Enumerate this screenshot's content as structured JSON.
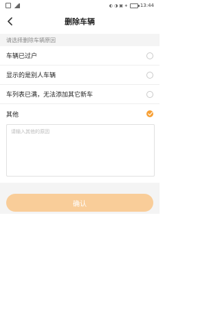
{
  "status_bar": {
    "left_indicators": "[Sm] .ull",
    "right_indicators": "☾ ◔ 🔔 ✱",
    "time": "13:44"
  },
  "header": {
    "title": "删除车辆",
    "back_icon": "chevron-left-icon"
  },
  "section_label": "请选择删除车辆原因",
  "options": [
    {
      "label": "车辆已过户",
      "checked": false
    },
    {
      "label": "显示的是别人车辆",
      "checked": false
    },
    {
      "label": "车列表已满，无法添加其它新车",
      "checked": false
    },
    {
      "label": "其他",
      "checked": true
    }
  ],
  "reason_input": {
    "placeholder": "请输入其他的原因",
    "value": ""
  },
  "confirm_button": {
    "label": "确认"
  },
  "colors": {
    "accent": "#f7a035",
    "confirm_disabled": "#f9cd99",
    "section_bg": "#f4f4f4"
  }
}
